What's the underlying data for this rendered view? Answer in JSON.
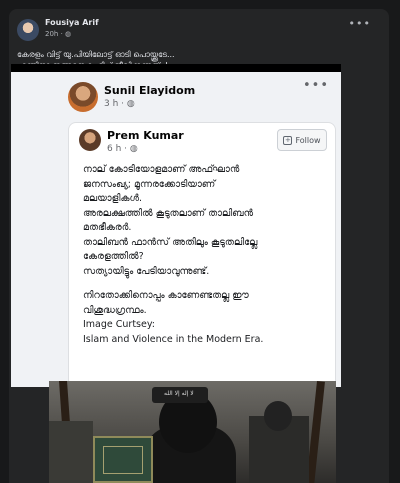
{
  "post": {
    "author": "Fousiya Arif",
    "meta": "20h · ",
    "more": "•••",
    "text_line1": "കേരളം വിട്ട് യു.പിയിലോട്ട് ഓടി പൊയ്ക്കൂടേ...",
    "text_line2": "എന്തിനാ ഇങ്ങനെ പേടിച്ച് ജീവിക്കണത്..!"
  },
  "screenshot": {
    "author": "Sunil Elayidom",
    "meta": "3 h · ",
    "more": "•••",
    "shared_post": {
      "author": "Prem Kumar",
      "meta": "6 h · ",
      "follow_label": "Follow",
      "lines": [
        "നാല് കോടിയോളമാണ് അഫ്ഘാൻ",
        "ജനസംഖ്യ; മൂന്നരക്കോടിയാണ്",
        "മലയാളികൾ.",
        "അരലക്ഷത്തിൽ കൂടുതലാണ് താലിബൻ",
        "മതഭീകരർ.",
        "താലിബൻ ഫാൻസ് അതിലും കൂടുതലില്ലേ",
        "കേരളത്തിൽ?",
        "സത്യായിട്ടും പേടിയാവുന്നുണ്ട്."
      ],
      "lines2": [
        "നിറതോക്കിനൊപ്പം കാണേണ്ടതല്ല ഈ",
        "വിശുദ്ധഗ്രന്ഥം.",
        "Image Curtsey:",
        "Islam and Violence in the Modern Era."
      ]
    },
    "photo_banner": "لا إله إلا الله"
  },
  "colors": {
    "background": "#18191a",
    "card": "#242526",
    "shared_bg": "#f0f2f5"
  }
}
